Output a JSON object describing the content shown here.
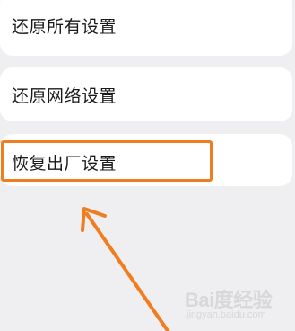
{
  "settings": {
    "items": [
      {
        "label": "还原所有设置"
      },
      {
        "label": "还原网络设置"
      },
      {
        "label": "恢复出厂设置"
      }
    ]
  },
  "annotation": {
    "color": "#f07d20",
    "highlight_target": "恢复出厂设置"
  },
  "watermark": {
    "brand": "Bai度经验",
    "url": "jingyan.baidu.com"
  }
}
